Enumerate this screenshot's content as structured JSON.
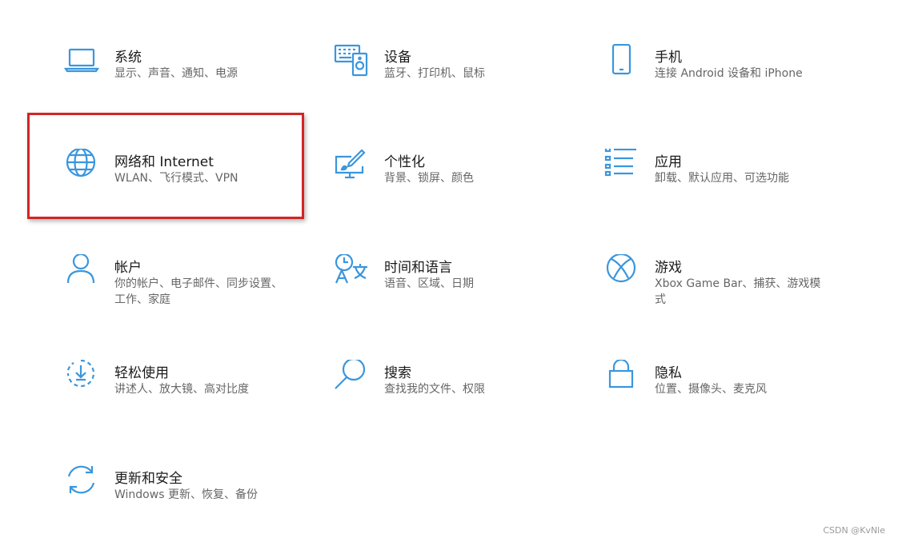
{
  "accent_color": "#3a96dd",
  "highlight_color": "#d42424",
  "tiles": [
    {
      "id": "system",
      "icon": "laptop-icon",
      "title": "系统",
      "desc": "显示、声音、通知、电源"
    },
    {
      "id": "devices",
      "icon": "devices-icon",
      "title": "设备",
      "desc": "蓝牙、打印机、鼠标"
    },
    {
      "id": "phone",
      "icon": "phone-icon",
      "title": "手机",
      "desc": "连接 Android 设备和 iPhone"
    },
    {
      "id": "network",
      "icon": "globe-icon",
      "title": "网络和 Internet",
      "desc": "WLAN、飞行模式、VPN"
    },
    {
      "id": "personalization",
      "icon": "paint-monitor-icon",
      "title": "个性化",
      "desc": "背景、锁屏、颜色"
    },
    {
      "id": "apps",
      "icon": "app-list-icon",
      "title": "应用",
      "desc": "卸载、默认应用、可选功能"
    },
    {
      "id": "accounts",
      "icon": "person-icon",
      "title": "帐户",
      "desc": "你的帐户、电子邮件、同步设置、工作、家庭"
    },
    {
      "id": "time-language",
      "icon": "time-language-icon",
      "title": "时间和语言",
      "desc": "语音、区域、日期"
    },
    {
      "id": "gaming",
      "icon": "xbox-icon",
      "title": "游戏",
      "desc": "Xbox Game Bar、捕获、游戏模式"
    },
    {
      "id": "ease-of-access",
      "icon": "ease-of-access-icon",
      "title": "轻松使用",
      "desc": "讲述人、放大镜、高对比度"
    },
    {
      "id": "search",
      "icon": "magnifier-icon",
      "title": "搜索",
      "desc": "查找我的文件、权限"
    },
    {
      "id": "privacy",
      "icon": "lock-icon",
      "title": "隐私",
      "desc": "位置、摄像头、麦克风"
    },
    {
      "id": "update-security",
      "icon": "refresh-icon",
      "title": "更新和安全",
      "desc": "Windows 更新、恢复、备份"
    }
  ],
  "watermark": "CSDN @KvNle"
}
